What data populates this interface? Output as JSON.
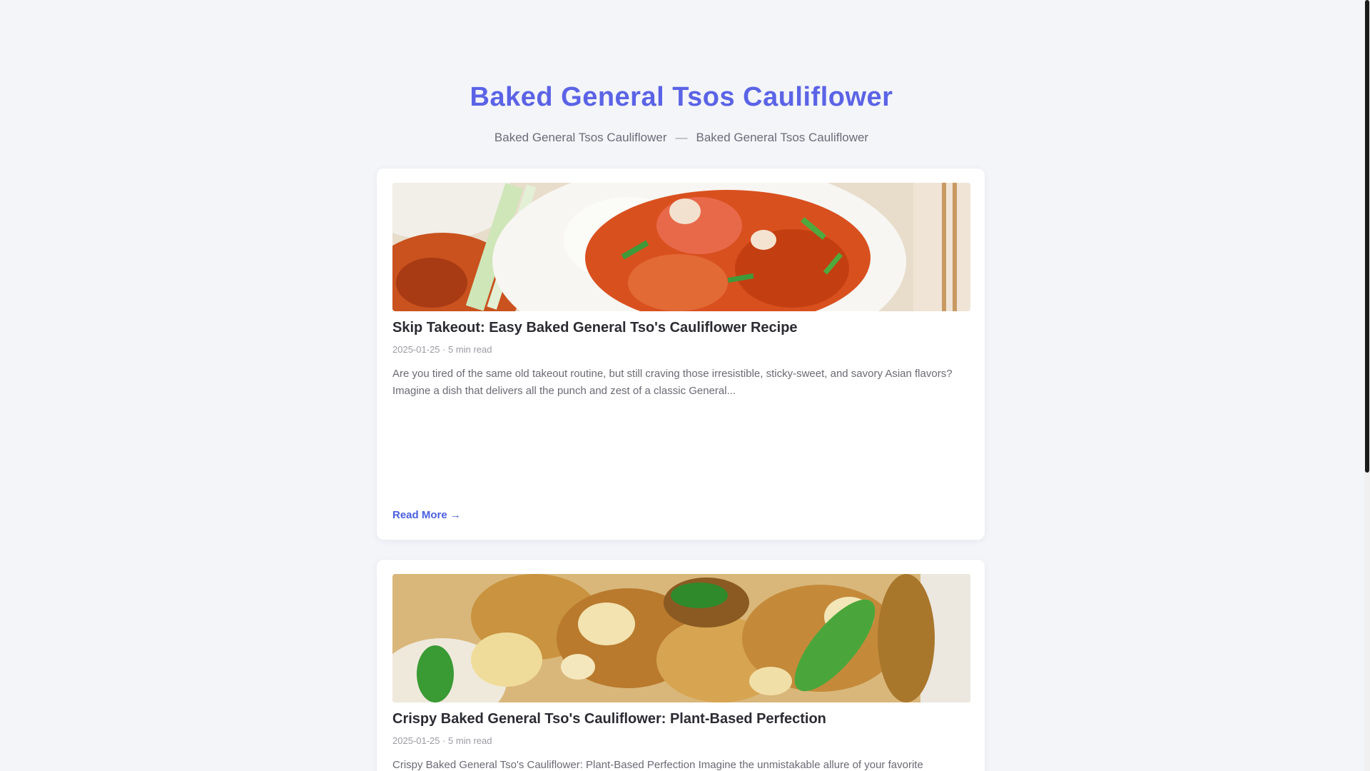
{
  "site": {
    "title": "Baked General Tsos Cauliflower"
  },
  "breadcrumb": {
    "home": "Baked General Tsos Cauliflower",
    "separator": "—",
    "current": "Baked General Tsos Cauliflower"
  },
  "posts": [
    {
      "title": "Skip Takeout: Easy Baked General Tso's Cauliflower Recipe",
      "meta": "2025-01-25 · 5 min read",
      "excerpt": "Are you tired of the same old takeout routine, but still craving those irresistible, sticky-sweet, and savory Asian flavors? Imagine a dish that delivers all the punch and zest of a classic General...",
      "read_more": "Read More →",
      "image": "general-tso-cauliflower-plate-photo"
    },
    {
      "title": "Crispy Baked General Tso's Cauliflower: Plant-Based Perfection",
      "meta": "2025-01-25 · 5 min read",
      "excerpt": "Crispy Baked General Tso's Cauliflower: Plant-Based Perfection Imagine the unmistakable allure of your favorite Chinese",
      "read_more": "",
      "image": "crispy-cauliflower-green-pepper-photo"
    }
  ],
  "colors": {
    "accent": "#5b63e6",
    "link": "#4a5fe0",
    "background": "#f3f5f9"
  }
}
